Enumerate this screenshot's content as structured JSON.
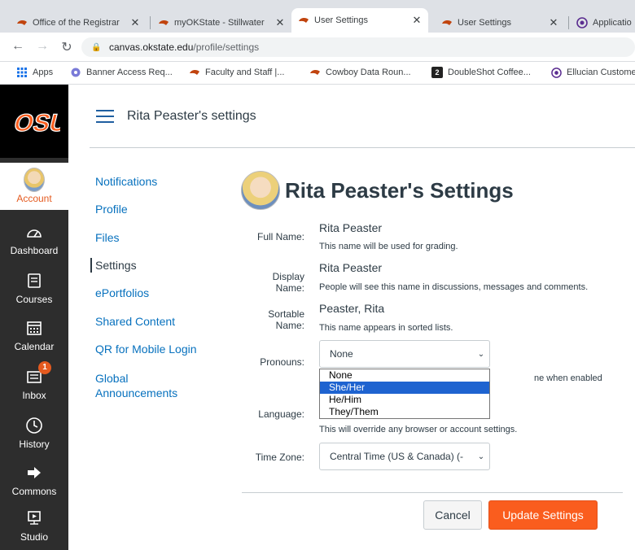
{
  "browser": {
    "tabs": [
      {
        "title": "Office of the Registrar",
        "close": "✕",
        "active": false
      },
      {
        "title": "myOKState - Stillwater",
        "close": "✕",
        "active": false
      },
      {
        "title": "User Settings",
        "close": "✕",
        "active": true
      },
      {
        "title": "User Settings",
        "close": "✕",
        "active": false
      },
      {
        "title": "Applicatio",
        "close": "",
        "active": false
      }
    ],
    "url_host": "canvas.okstate.edu",
    "url_path": "/profile/settings",
    "bookmarks": [
      {
        "label": "Apps"
      },
      {
        "label": "Banner Access Req..."
      },
      {
        "label": "Faculty and Staff |..."
      },
      {
        "label": "Cowboy Data Roun..."
      },
      {
        "label": "DoubleShot Coffee..."
      },
      {
        "label": "Ellucian Custome"
      }
    ]
  },
  "global_nav": {
    "logo_text": "OSU",
    "items": [
      {
        "label": "Account",
        "icon": "avatar",
        "active": true
      },
      {
        "label": "Dashboard",
        "icon": "dashboard-icon"
      },
      {
        "label": "Courses",
        "icon": "courses-icon"
      },
      {
        "label": "Calendar",
        "icon": "calendar-icon"
      },
      {
        "label": "Inbox",
        "icon": "inbox-icon",
        "badge": "1"
      },
      {
        "label": "History",
        "icon": "clock-icon"
      },
      {
        "label": "Commons",
        "icon": "commons-icon"
      },
      {
        "label": "Studio",
        "icon": "studio-icon"
      }
    ]
  },
  "header": {
    "title": "Rita Peaster's settings"
  },
  "section_nav": [
    {
      "label": "Notifications",
      "active": false
    },
    {
      "label": "Profile",
      "active": false
    },
    {
      "label": "Files",
      "active": false
    },
    {
      "label": "Settings",
      "active": true
    },
    {
      "label": "ePortfolios",
      "active": false
    },
    {
      "label": "Shared Content",
      "active": false
    },
    {
      "label": "QR for Mobile Login",
      "active": false
    },
    {
      "label": "Global Announcements",
      "active": false
    }
  ],
  "main": {
    "title": "Rita Peaster's Settings",
    "full_name": {
      "label": "Full Name:",
      "value": "Rita Peaster",
      "hint": "This name will be used for grading."
    },
    "display_name": {
      "label": "Display Name:",
      "value": "Rita Peaster",
      "hint": "People will see this name in discussions, messages and comments."
    },
    "sortable_name": {
      "label": "Sortable Name:",
      "value": "Peaster, Rita",
      "hint": "This name appears in sorted lists."
    },
    "pronouns": {
      "label": "Pronouns:",
      "value": "None",
      "hint_partial": "ne when enabled",
      "options": [
        "None",
        "She/Her",
        "He/Him",
        "They/Them"
      ],
      "highlighted": "She/Her"
    },
    "language": {
      "label": "Language:",
      "hint": "This will override any browser or account settings."
    },
    "time_zone": {
      "label": "Time Zone:",
      "value": "Central Time (US & Canada) (-"
    },
    "cancel_label": "Cancel",
    "update_label": "Update Settings"
  },
  "colors": {
    "accent": "#fa5d1e",
    "link": "#0771be",
    "nav_bg": "#2d2d2d",
    "selected_option": "#1e63d0"
  }
}
